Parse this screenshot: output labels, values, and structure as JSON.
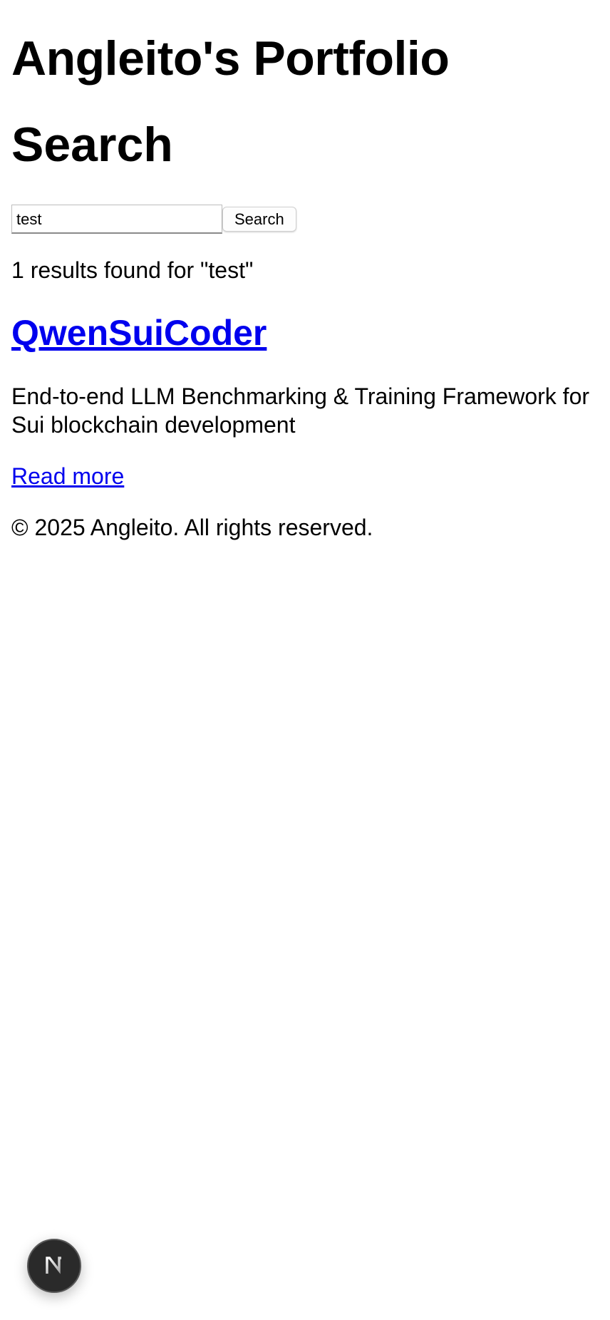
{
  "header": {
    "site_title": "Angleito's Portfolio"
  },
  "search": {
    "heading": "Search",
    "input_value": "test",
    "button_label": "Search"
  },
  "results": {
    "summary": "1 results found for \"test\"",
    "items": [
      {
        "title": "QwenSuiCoder",
        "description": "End-to-end LLM Benchmarking & Training Framework for Sui blockchain development",
        "link_label": "Read more"
      }
    ]
  },
  "footer": {
    "text": "© 2025 Angleito. All rights reserved."
  },
  "dev_indicator": {
    "icon": "nextjs-logo-icon",
    "letter": "N"
  },
  "colors": {
    "link": "#0000ee",
    "text": "#000000",
    "badge_bg": "#2a2a2a"
  }
}
